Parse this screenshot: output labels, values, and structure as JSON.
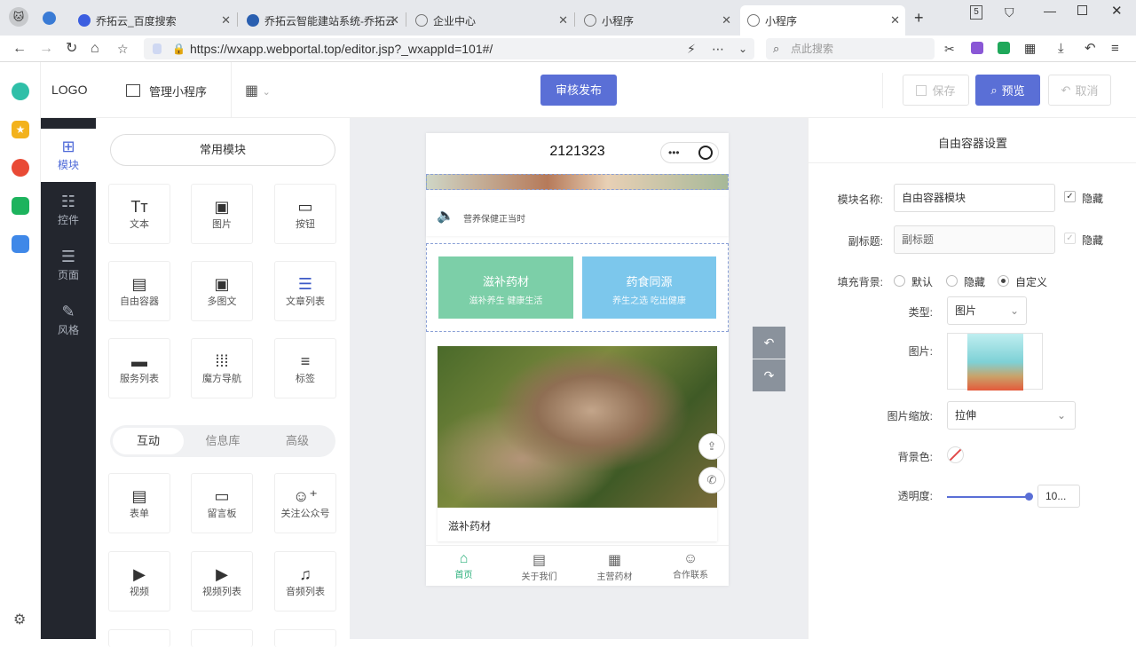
{
  "browser": {
    "tabs": [
      {
        "title": "乔拓云_百度搜索"
      },
      {
        "title": "乔拓云智能建站系统-乔拓云"
      },
      {
        "title": "企业中心"
      },
      {
        "title": "小程序"
      },
      {
        "title": "小程序"
      }
    ],
    "url": "https://wxapp.webportal.top/editor.jsp?_wxappId=101#/",
    "search_placeholder": "点此搜索",
    "window_badge": "5"
  },
  "header": {
    "logo": "LOGO",
    "manage_label": "管理小程序",
    "publish_label": "审核发布",
    "save_label": "保存",
    "preview_label": "预览",
    "cancel_label": "取消"
  },
  "nav": [
    {
      "label": "模块",
      "icon": "module-icon"
    },
    {
      "label": "控件",
      "icon": "controls-icon"
    },
    {
      "label": "页面",
      "icon": "pages-icon"
    },
    {
      "label": "风格",
      "icon": "style-icon"
    }
  ],
  "panel": {
    "common_title": "常用模块",
    "common_modules": [
      "文本",
      "图片",
      "按钮",
      "自由容器",
      "多图文",
      "文章列表",
      "服务列表",
      "魔方导航",
      "标签"
    ],
    "tabs": [
      "互动",
      "信息库",
      "高级"
    ],
    "interactive_modules": [
      "表单",
      "留言板",
      "关注公众号",
      "视频",
      "视频列表",
      "音频列表"
    ]
  },
  "phone": {
    "title": "2121323",
    "notice": "营养保健正当时",
    "cards": [
      {
        "title": "滋补药材",
        "sub": "滋补养生 健康生活",
        "color": "#7ccfa8"
      },
      {
        "title": "药食同源",
        "sub": "养生之选 吃出健康",
        "color": "#7cc7ec"
      }
    ],
    "image_caption": "滋补药材",
    "tabbar": [
      "首页",
      "关于我们",
      "主营药材",
      "合作联系"
    ]
  },
  "settings": {
    "title": "自由容器设置",
    "name_label": "模块名称:",
    "name_value": "自由容器模块",
    "hide_label": "隐藏",
    "subtitle_label": "副标题:",
    "subtitle_value": "副标题",
    "bg_label": "填充背景:",
    "bg_options": [
      "默认",
      "隐藏",
      "自定义"
    ],
    "type_label": "类型:",
    "type_value": "图片",
    "image_label": "图片:",
    "scale_label": "图片缩放:",
    "scale_value": "拉伸",
    "color_label": "背景色:",
    "opacity_label": "透明度:",
    "opacity_value": "10...",
    "opacity_level": 0.98
  }
}
